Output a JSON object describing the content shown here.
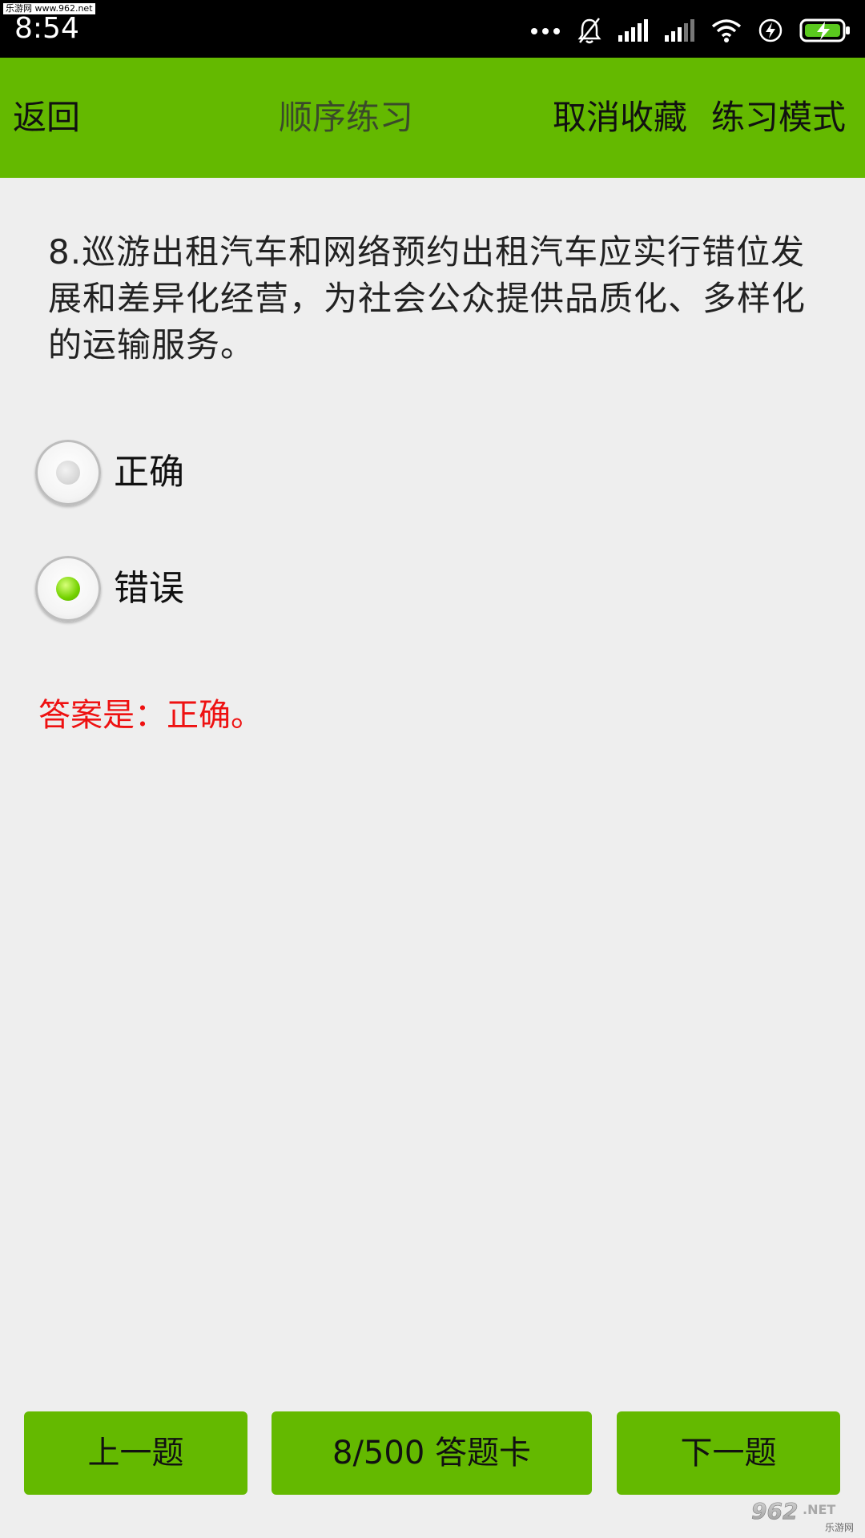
{
  "status_bar": {
    "watermark": "乐游网 www.962.net",
    "time": "8:54",
    "icons": [
      "more-dots-icon",
      "notifications-off-icon",
      "signal-icon",
      "signal-icon",
      "wifi-icon",
      "charging-icon",
      "battery-icon"
    ]
  },
  "toolbar": {
    "back_label": "返回",
    "title": "顺序练习",
    "unfavorite_label": "取消收藏",
    "mode_label": "练习模式",
    "background": "#64b900"
  },
  "question": {
    "text": "8.巡游出租汽车和网络预约出租汽车应实行错位发展和差异化经营，为社会公众提供品质化、多样化的运输服务。"
  },
  "options": [
    {
      "label": "正确",
      "selected": false
    },
    {
      "label": "错误",
      "selected": true
    }
  ],
  "answer": {
    "text": "答案是：正确。",
    "color": "#ee1111"
  },
  "footer": {
    "prev_label": "上一题",
    "card_label": "8/500 答题卡",
    "next_label": "下一题"
  },
  "watermark_bottom": {
    "logo": "962.NET",
    "text": "乐游网"
  }
}
